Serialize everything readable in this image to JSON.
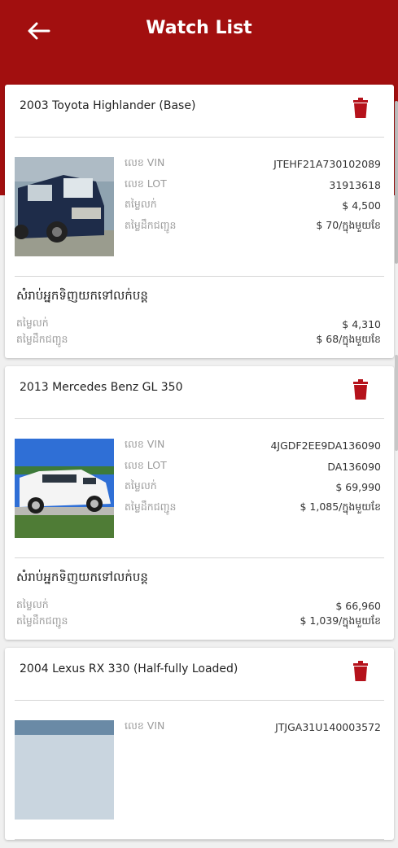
{
  "header": {
    "title": "Watch List",
    "back_icon": "arrow-left-icon",
    "color": "#a20f0f"
  },
  "labels": {
    "vin": "លេខ VIN",
    "lot": "លេខ LOT",
    "price": "តម្លៃលក់",
    "shipping": "តម្លៃដឹកជញ្ជូន",
    "buyer_section": "សំរាប់អ្នកទិញយកទៅលក់បន្ត"
  },
  "cars": [
    {
      "name": "2003 Toyota Highlander (Base)",
      "vin": "JTEHF21A730102089",
      "lot": "31913618",
      "price": "$ 4,500",
      "shipping": "$ 70/ក្នុងមួយខែ",
      "resale_price": "$ 4,310",
      "resale_shipping": "$ 68/ក្នុងមួយខែ",
      "image": "dark-blue-suv-photo"
    },
    {
      "name": "2013 Mercedes Benz GL 350",
      "vin": "4JGDF2EE9DA136090",
      "lot": "DA136090",
      "price": "$ 69,990",
      "shipping": "$ 1,085/ក្នុងមួយខែ",
      "resale_price": "$ 66,960",
      "resale_shipping": "$ 1,039/ក្នុងមួយខែ",
      "image": "white-suv-photo"
    },
    {
      "name": "2004 Lexus RX 330 (Half-fully Loaded)",
      "vin": "JTJGA31U140003572",
      "image": "lexus-photo"
    }
  ]
}
